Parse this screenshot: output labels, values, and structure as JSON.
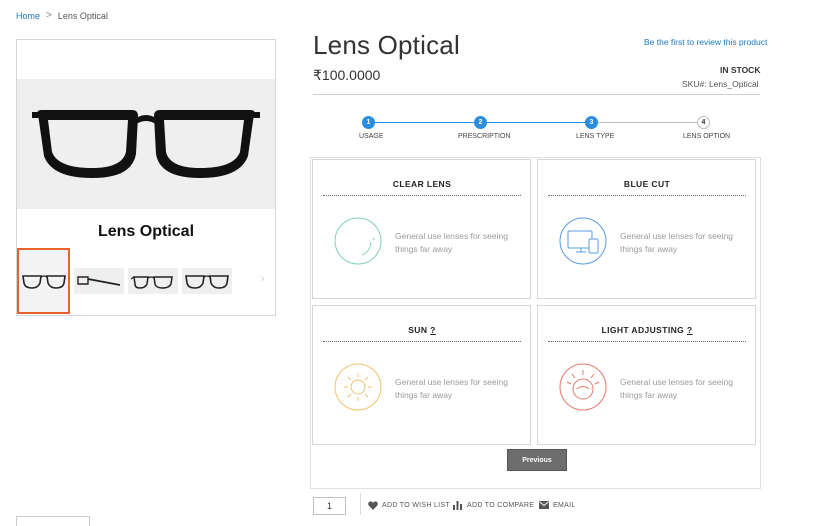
{
  "breadcrumb": {
    "home": "Home",
    "separator": ">",
    "current": "Lens Optical"
  },
  "gallery": {
    "caption": "Lens Optical",
    "thumbnail_count": 4,
    "next_arrow": "›"
  },
  "product": {
    "title": "Lens Optical",
    "review_link": "Be the first to review this product",
    "price": "₹100.0000",
    "stock": "IN STOCK",
    "sku_label": "SKU#:",
    "sku_value": "Lens_Optical"
  },
  "steps": [
    {
      "number": "1",
      "label": "USAGE",
      "state": "done"
    },
    {
      "number": "2",
      "label": "PRESCRIPTION",
      "state": "done"
    },
    {
      "number": "3",
      "label": "LENS TYPE",
      "state": "done"
    },
    {
      "number": "4",
      "label": "LENS OPTION",
      "state": "todo"
    }
  ],
  "lens_options": [
    {
      "title": "CLEAR LENS",
      "suffix": "",
      "description": "General use lenses for seeing things far away",
      "icon": "clear-lens-icon",
      "color": "#7fd3b4"
    },
    {
      "title": "BLUE CUT",
      "suffix": "",
      "description": "General use lenses for seeing things far away",
      "icon": "screen-devices-icon",
      "color": "#5a9ae0"
    },
    {
      "title": "SUN",
      "suffix": "?",
      "description": "General use lenses for seeing things far away",
      "icon": "sun-icon",
      "color": "#f0c070"
    },
    {
      "title": "LIGHT ADJUSTING",
      "suffix": "?",
      "description": "General use lenses for seeing things far away",
      "icon": "light-adjusting-icon",
      "color": "#e8786a"
    }
  ],
  "previous_button": "Previous",
  "quantity": "1",
  "actions": {
    "wishlist": "ADD TO WISH LIST",
    "compare": "ADD TO COMPARE",
    "email": "EMAIL"
  },
  "colors": {
    "accent": "#1979c3",
    "step_active": "#2a8ee0",
    "thumb_border": "#e8622c"
  }
}
